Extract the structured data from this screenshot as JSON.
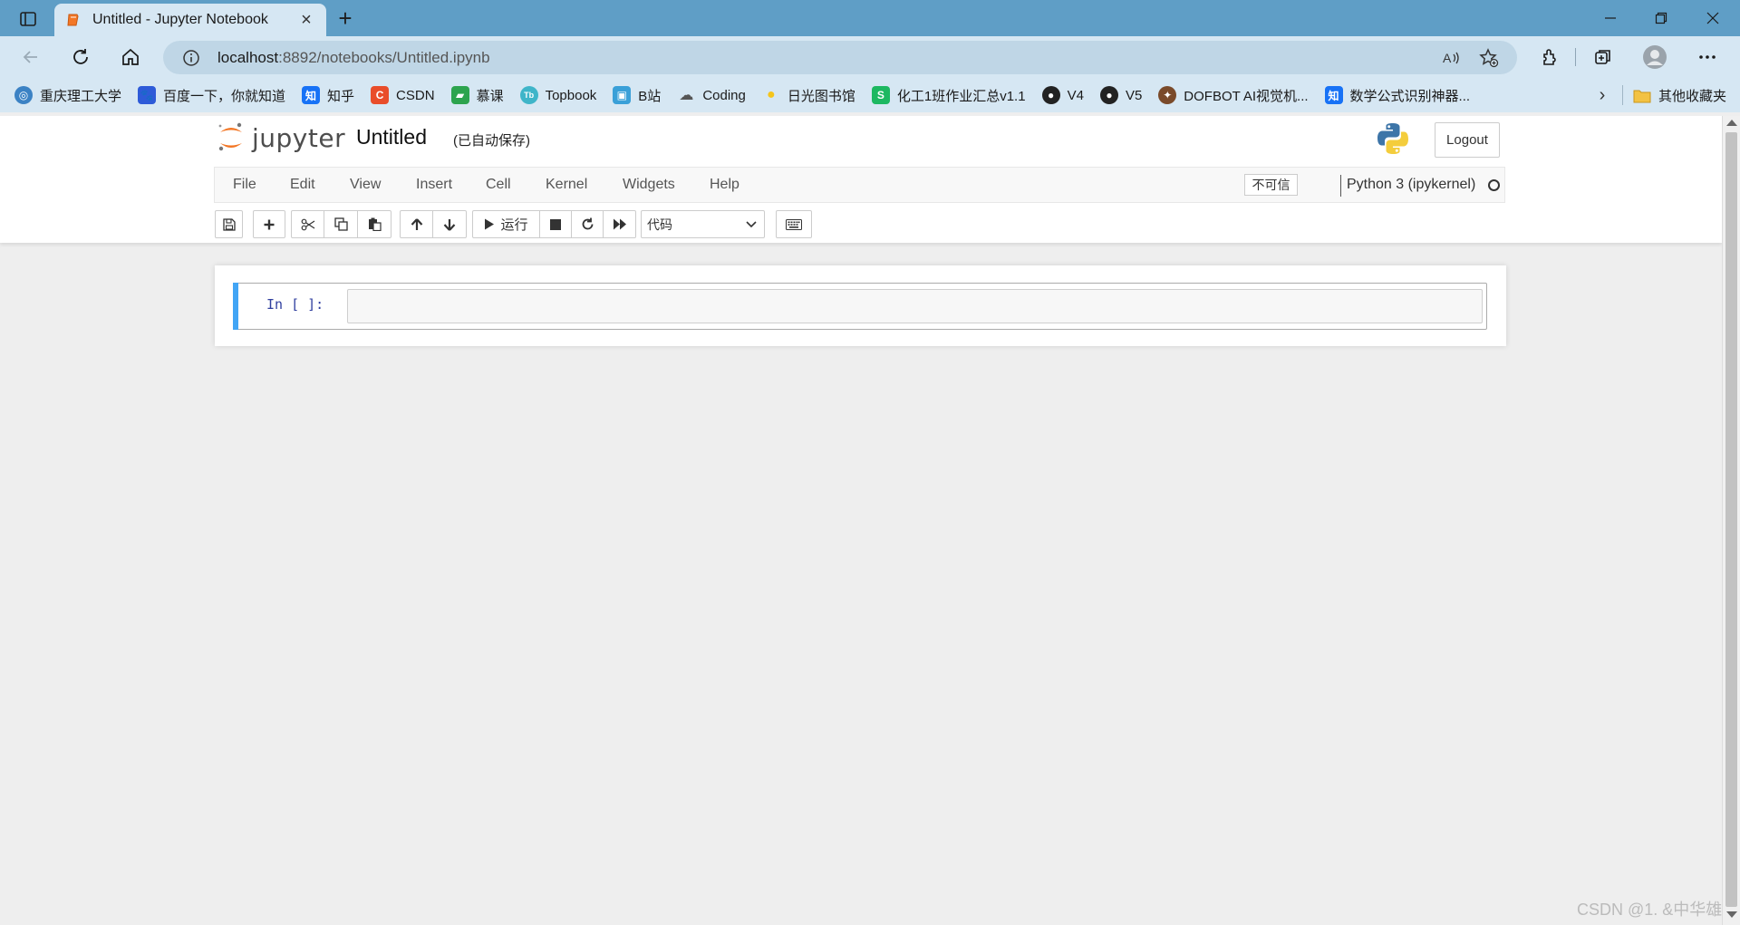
{
  "browser": {
    "tab": {
      "title": "Untitled - Jupyter Notebook"
    },
    "address": {
      "host": "localhost",
      "rest": ":8892/notebooks/Untitled.ipynb"
    },
    "bookmarks": [
      {
        "label": "重庆理工大学",
        "icon": "cqut-icon",
        "color": "#3b82c4"
      },
      {
        "label": "百度一下，你就知道",
        "icon": "baidu-icon",
        "color": "#2e5bd8"
      },
      {
        "label": "知乎",
        "icon": "zhihu-icon",
        "color": "#1772f6"
      },
      {
        "label": "CSDN",
        "icon": "csdn-icon",
        "color": "#e94d2a"
      },
      {
        "label": "慕课",
        "icon": "mooc-icon",
        "color": "#2da44e"
      },
      {
        "label": "Topbook",
        "icon": "topbook-icon",
        "color": "#3fb5c9"
      },
      {
        "label": "B站",
        "icon": "bilibili-icon",
        "color": "#3aa0d8"
      },
      {
        "label": "Coding",
        "icon": "coding-icon",
        "color": "#555555"
      },
      {
        "label": "日光图书馆",
        "icon": "sun-icon",
        "color": "#f5c51b"
      },
      {
        "label": "化工1班作业汇总v1.1",
        "icon": "sheet-icon",
        "color": "#1db861"
      },
      {
        "label": "V4",
        "icon": "github-icon",
        "color": "#222222"
      },
      {
        "label": "V5",
        "icon": "github-icon",
        "color": "#222222"
      },
      {
        "label": "DOFBOT AI视觉机...",
        "icon": "dofbot-icon",
        "color": "#7a4a2a"
      },
      {
        "label": "数学公式识别神器...",
        "icon": "zhihu-icon",
        "color": "#1772f6"
      }
    ],
    "other_bookmarks": "其他收藏夹"
  },
  "jupyter": {
    "logo_text": "jupyter",
    "notebook_name": "Untitled",
    "autosave_status": "(已自动保存)",
    "logout_label": "Logout",
    "menu": {
      "file": "File",
      "edit": "Edit",
      "view": "View",
      "insert": "Insert",
      "cell": "Cell",
      "kernel": "Kernel",
      "widgets": "Widgets",
      "help": "Help"
    },
    "trust_label": "不可信",
    "kernel_name": "Python 3 (ipykernel)",
    "toolbar": {
      "run_label": "运行",
      "cell_type": "代码"
    },
    "cell": {
      "prompt": "In [ ]:",
      "content": ""
    }
  },
  "watermark": "CSDN @1. &中华雄"
}
